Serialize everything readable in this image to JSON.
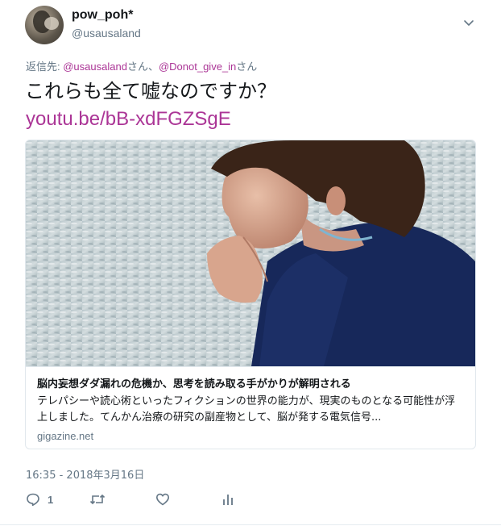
{
  "user": {
    "display_name": "pow_poh*",
    "handle": "@usausaland"
  },
  "reply": {
    "prefix": "返信先: ",
    "mention_1": "@usausaland",
    "san_1": "さん、",
    "mention_2": "@Donot_give_in",
    "san_2": "さん"
  },
  "tweet": {
    "text": "これらも全て嘘なのですか？",
    "link": "youtu.be/bB-xdFGZSgE",
    "timestamp": "16:35 - 2018年3月16日"
  },
  "card": {
    "title": "脳内妄想ダダ漏れの危機か、思考を読み取る手がかりが解明される",
    "description": "テレパシーや読心術といったフィクションの世界の能力が、現実のものとなる可能性が浮上しました。てんかん治療の研究の副産物として、脳が発する電気信号...",
    "domain": "gigazine.net",
    "image_alt": "woman-thinking-photo"
  },
  "actions": {
    "reply_count": "1",
    "icons": [
      "reply-icon",
      "retweet-icon",
      "like-icon",
      "analytics-icon"
    ]
  },
  "colors": {
    "link": "#ab3596",
    "muted": "#657786",
    "text": "#14171a",
    "border": "#e1e8ed"
  }
}
